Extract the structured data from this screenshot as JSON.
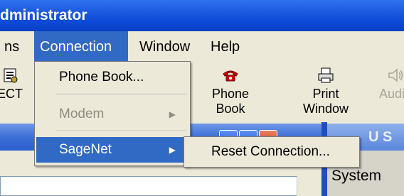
{
  "window": {
    "title": "dministrator"
  },
  "menubar": {
    "items": [
      {
        "label": "ns"
      },
      {
        "label": "Connection"
      },
      {
        "label": "Window"
      },
      {
        "label": "Help"
      }
    ]
  },
  "toolbar": {
    "buttons": [
      {
        "label": "ECT",
        "icon": "connect-icon"
      },
      {
        "label": "Phone Book",
        "line1": "Phone",
        "line2": "Book",
        "icon": "red-phone-icon"
      },
      {
        "label": "Print Window",
        "line1": "Print",
        "line2": "Window",
        "icon": "printer-icon"
      },
      {
        "label": "Audio",
        "icon": "speaker-icon",
        "disabled": true
      }
    ]
  },
  "connection_menu": {
    "items": [
      {
        "label": "Phone Book..."
      },
      {
        "label": "Modem",
        "disabled": true,
        "submenu": true
      },
      {
        "label": "SageNet",
        "submenu": true,
        "highlighted": true
      }
    ]
  },
  "sagenet_submenu": {
    "items": [
      {
        "label": "Reset Connection..."
      }
    ]
  },
  "right_panel": {
    "title": "U S",
    "label": "System"
  },
  "colors": {
    "accent": "#316ac5",
    "titlebar": "#0d4ad8"
  }
}
